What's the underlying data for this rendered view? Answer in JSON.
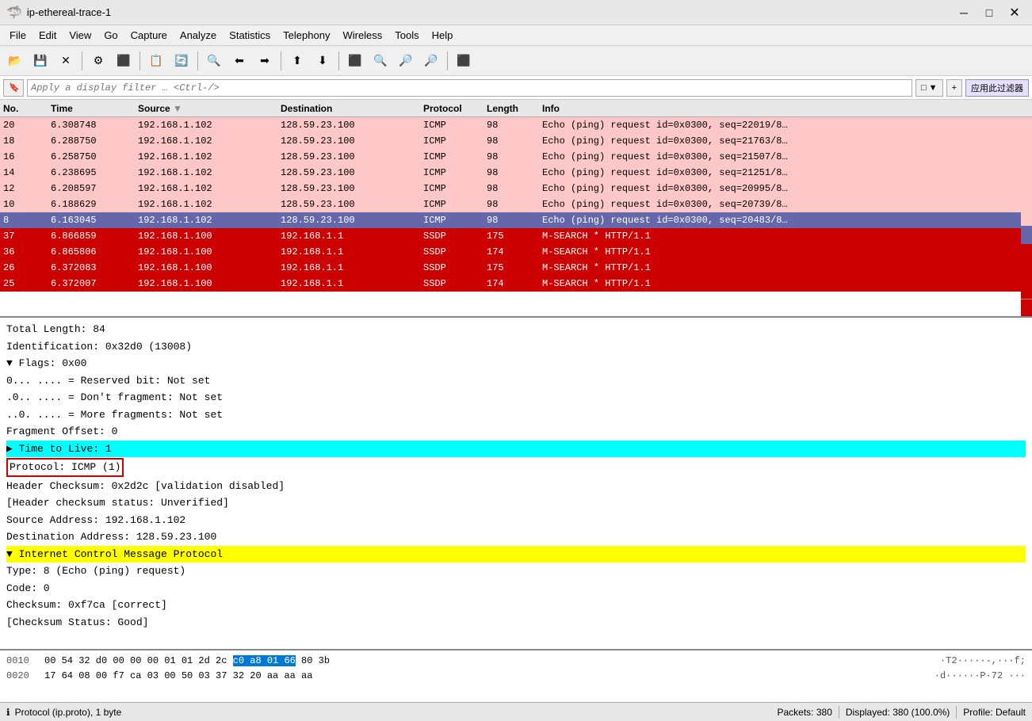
{
  "titlebar": {
    "icon": "🦈",
    "title": "ip-ethereal-trace-1",
    "minimize": "─",
    "maximize": "□",
    "close": "✕"
  },
  "menubar": {
    "items": [
      "File",
      "Edit",
      "View",
      "Go",
      "Capture",
      "Analyze",
      "Statistics",
      "Telephony",
      "Wireless",
      "Tools",
      "Help"
    ]
  },
  "toolbar": {
    "buttons": [
      "📁",
      "💾",
      "✕",
      "⚙",
      "⬛",
      "⬛",
      "📋",
      "🔄",
      "🔍",
      "⬅",
      "➡",
      "⬛",
      "⬆",
      "⬇",
      "⬛",
      "✕",
      "🔍",
      "🔎",
      "🔎",
      "⬛"
    ]
  },
  "filterbar": {
    "placeholder": "Apply a display filter … <Ctrl-/>",
    "value": "",
    "button1": "□",
    "button2": "▼",
    "button3": "+",
    "apply_label": "应用此过滤器"
  },
  "packet_list": {
    "columns": [
      "No.",
      "Time",
      "Source",
      "Destination",
      "Protocol",
      "Length",
      "Info"
    ],
    "rows": [
      {
        "no": "20",
        "time": "6.308748",
        "src": "192.168.1.102",
        "dst": "128.59.23.100",
        "proto": "ICMP",
        "len": "98",
        "info": "Echo (ping) request  id=0x0300, seq=22019/8…",
        "color": "pink"
      },
      {
        "no": "18",
        "time": "6.288750",
        "src": "192.168.1.102",
        "dst": "128.59.23.100",
        "proto": "ICMP",
        "len": "98",
        "info": "Echo (ping) request  id=0x0300, seq=21763/8…",
        "color": "pink"
      },
      {
        "no": "16",
        "time": "6.258750",
        "src": "192.168.1.102",
        "dst": "128.59.23.100",
        "proto": "ICMP",
        "len": "98",
        "info": "Echo (ping) request  id=0x0300, seq=21507/8…",
        "color": "pink"
      },
      {
        "no": "14",
        "time": "6.238695",
        "src": "192.168.1.102",
        "dst": "128.59.23.100",
        "proto": "ICMP",
        "len": "98",
        "info": "Echo (ping) request  id=0x0300, seq=21251/8…",
        "color": "pink"
      },
      {
        "no": "12",
        "time": "6.208597",
        "src": "192.168.1.102",
        "dst": "128.59.23.100",
        "proto": "ICMP",
        "len": "98",
        "info": "Echo (ping) request  id=0x0300, seq=20995/8…",
        "color": "pink"
      },
      {
        "no": "10",
        "time": "6.188629",
        "src": "192.168.1.102",
        "dst": "128.59.23.100",
        "proto": "ICMP",
        "len": "98",
        "info": "Echo (ping) request  id=0x0300, seq=20739/8…",
        "color": "pink"
      },
      {
        "no": "8",
        "time": "6.163045",
        "src": "192.168.1.102",
        "dst": "128.59.23.100",
        "proto": "ICMP",
        "len": "98",
        "info": "Echo (ping) request  id=0x0300, seq=20483/8…",
        "color": "selected"
      },
      {
        "no": "37",
        "time": "6.866859",
        "src": "192.168.1.100",
        "dst": "192.168.1.1",
        "proto": "SSDP",
        "len": "175",
        "info": "M-SEARCH * HTTP/1.1",
        "color": "red"
      },
      {
        "no": "36",
        "time": "6.865806",
        "src": "192.168.1.100",
        "dst": "192.168.1.1",
        "proto": "SSDP",
        "len": "174",
        "info": "M-SEARCH * HTTP/1.1",
        "color": "red"
      },
      {
        "no": "26",
        "time": "6.372083",
        "src": "192.168.1.100",
        "dst": "192.168.1.1",
        "proto": "SSDP",
        "len": "175",
        "info": "M-SEARCH * HTTP/1.1",
        "color": "red"
      },
      {
        "no": "25",
        "time": "6.372007",
        "src": "192.168.1.100",
        "dst": "192.168.1.1",
        "proto": "SSDP",
        "len": "174",
        "info": "M-SEARCH * HTTP/1.1",
        "color": "red"
      }
    ]
  },
  "detail_pane": {
    "lines": [
      {
        "text": "Total Length: 84",
        "indent": 0,
        "style": "normal"
      },
      {
        "text": "Identification: 0x32d0 (13008)",
        "indent": 0,
        "style": "normal"
      },
      {
        "text": "▼ Flags: 0x00",
        "indent": 0,
        "style": "normal",
        "expandable": true
      },
      {
        "text": "0... ....  = Reserved bit: Not set",
        "indent": 1,
        "style": "normal"
      },
      {
        "text": ".0.. ....  = Don't fragment: Not set",
        "indent": 1,
        "style": "normal"
      },
      {
        "text": "..0. ....  = More fragments: Not set",
        "indent": 1,
        "style": "normal"
      },
      {
        "text": "Fragment Offset: 0",
        "indent": 0,
        "style": "normal"
      },
      {
        "text": "▶ Time to Live: 1",
        "indent": 0,
        "style": "cyan",
        "expandable": true
      },
      {
        "text": "Protocol: ICMP (1)",
        "indent": 0,
        "style": "bordered"
      },
      {
        "text": "Header Checksum: 0x2d2c [validation disabled]",
        "indent": 0,
        "style": "normal"
      },
      {
        "text": "[Header checksum status: Unverified]",
        "indent": 0,
        "style": "normal"
      },
      {
        "text": "Source Address: 192.168.1.102",
        "indent": 0,
        "style": "normal"
      },
      {
        "text": "Destination Address: 128.59.23.100",
        "indent": 0,
        "style": "normal"
      },
      {
        "text": "▼ Internet Control Message Protocol",
        "indent": 0,
        "style": "yellow",
        "expandable": true
      },
      {
        "text": "Type: 8 (Echo (ping) request)",
        "indent": 1,
        "style": "normal"
      },
      {
        "text": "Code: 0",
        "indent": 1,
        "style": "normal"
      },
      {
        "text": "Checksum: 0xf7ca [correct]",
        "indent": 1,
        "style": "normal"
      },
      {
        "text": "[Checksum Status: Good]",
        "indent": 1,
        "style": "normal"
      }
    ]
  },
  "hex_pane": {
    "rows": [
      {
        "offset": "0010",
        "bytes": "00 54 32 d0 00 00 00 01  01 2d 2c",
        "bytes_highlight": "c0 a8 01 66",
        "bytes_rest": "80 3b",
        "ascii": "·T2·····-,",
        "ascii_highlight": "···f",
        "ascii_rest": ";"
      },
      {
        "offset": "0020",
        "bytes": "17 64 08 00 f7 ca 03 00  50 03 37 32 20 aa aa aa",
        "ascii": "·d······P·72 ···"
      }
    ]
  },
  "statusbar": {
    "left": "Protocol (ip.proto), 1 byte",
    "icon": "ℹ",
    "right_packets": "Packets: 380",
    "right_displayed": "Displayed: 380 (100.0%)",
    "right_profile": "Profile: Default"
  }
}
